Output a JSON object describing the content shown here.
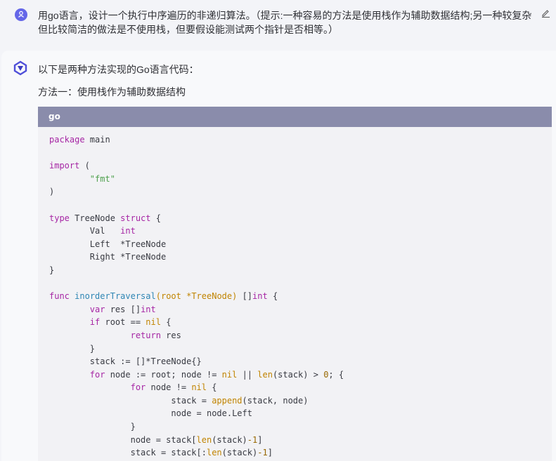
{
  "user_message": {
    "avatar_icon": "user-icon",
    "avatar_color": "#6466e8",
    "text": "用go语言，设计一个执行中序遍历的非递归算法。（提示:一种容易的方法是使用栈作为辅助数据结构;另一种较复杂但比较简洁的做法是不使用栈，但要假设能测试两个指针是否相等。）",
    "edit_icon": "pencil-icon"
  },
  "assistant_message": {
    "avatar_icon": "ai-assistant-logo-icon",
    "intro": "以下是两种方法实现的Go语言代码：",
    "method_one": "方法一：使用栈作为辅助数据结构",
    "code_block": {
      "language": "go",
      "header_color": "#8a8cab",
      "lines": [
        [
          {
            "t": "package",
            "c": "kw"
          },
          {
            "t": " main"
          }
        ],
        [],
        [
          {
            "t": "import",
            "c": "kw"
          },
          {
            "t": " ("
          }
        ],
        [
          {
            "t": "        "
          },
          {
            "t": "\"fmt\"",
            "c": "str"
          }
        ],
        [
          {
            "t": ")"
          }
        ],
        [],
        [
          {
            "t": "type",
            "c": "kw"
          },
          {
            "t": " TreeNode "
          },
          {
            "t": "struct",
            "c": "kw"
          },
          {
            "t": " {"
          }
        ],
        [
          {
            "t": "        Val   "
          },
          {
            "t": "int",
            "c": "ty"
          }
        ],
        [
          {
            "t": "        Left  *TreeNode"
          }
        ],
        [
          {
            "t": "        Right *TreeNode"
          }
        ],
        [
          {
            "t": "}"
          }
        ],
        [],
        [
          {
            "t": "func",
            "c": "kw"
          },
          {
            "t": " "
          },
          {
            "t": "inorderTraversal",
            "c": "fn"
          },
          {
            "t": "(",
            "c": "lit"
          },
          {
            "t": "root *TreeNode",
            "c": "lit"
          },
          {
            "t": ")",
            "c": "lit"
          },
          {
            "t": " []"
          },
          {
            "t": "int",
            "c": "ty"
          },
          {
            "t": " {"
          }
        ],
        [
          {
            "t": "        "
          },
          {
            "t": "var",
            "c": "kw"
          },
          {
            "t": " res []"
          },
          {
            "t": "int",
            "c": "ty"
          }
        ],
        [
          {
            "t": "        "
          },
          {
            "t": "if",
            "c": "kw"
          },
          {
            "t": " root == "
          },
          {
            "t": "nil",
            "c": "lit"
          },
          {
            "t": " {"
          }
        ],
        [
          {
            "t": "                "
          },
          {
            "t": "return",
            "c": "kw"
          },
          {
            "t": " res"
          }
        ],
        [
          {
            "t": "        }"
          }
        ],
        [
          {
            "t": "        stack := []*TreeNode{}"
          }
        ],
        [
          {
            "t": "        "
          },
          {
            "t": "for",
            "c": "kw"
          },
          {
            "t": " node := root; node != "
          },
          {
            "t": "nil",
            "c": "lit"
          },
          {
            "t": " || "
          },
          {
            "t": "len",
            "c": "bi"
          },
          {
            "t": "(stack) > "
          },
          {
            "t": "0",
            "c": "num"
          },
          {
            "t": "; {"
          }
        ],
        [
          {
            "t": "                "
          },
          {
            "t": "for",
            "c": "kw"
          },
          {
            "t": " node != "
          },
          {
            "t": "nil",
            "c": "lit"
          },
          {
            "t": " {"
          }
        ],
        [
          {
            "t": "                        stack = "
          },
          {
            "t": "append",
            "c": "bi"
          },
          {
            "t": "(stack, node)"
          }
        ],
        [
          {
            "t": "                        node = node.Left"
          }
        ],
        [
          {
            "t": "                }"
          }
        ],
        [
          {
            "t": "                node = stack["
          },
          {
            "t": "len",
            "c": "bi"
          },
          {
            "t": "(stack)"
          },
          {
            "t": "-1",
            "c": "num"
          },
          {
            "t": "]"
          }
        ],
        [
          {
            "t": "                stack = stack[:"
          },
          {
            "t": "len",
            "c": "bi"
          },
          {
            "t": "(stack)"
          },
          {
            "t": "-1",
            "c": "num"
          },
          {
            "t": "]"
          }
        ]
      ]
    }
  }
}
